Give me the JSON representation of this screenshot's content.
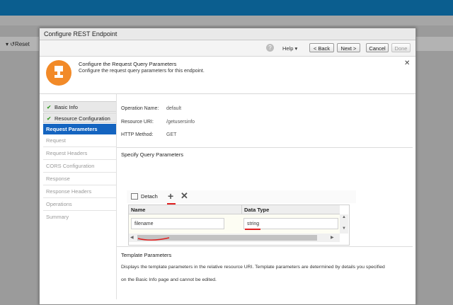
{
  "background": {
    "reset_label": "Reset"
  },
  "dialog": {
    "title": "Configure REST Endpoint",
    "toolbar": {
      "help_label": "Help",
      "back_label": "< Back",
      "next_label": "Next >",
      "cancel_label": "Cancel",
      "done_label": "Done"
    },
    "header": {
      "title": "Configure the Request Query Parameters",
      "subtitle": "Configure the request query parameters for this endpoint."
    },
    "nav": {
      "items": [
        {
          "label": "Basic Info",
          "state": "done"
        },
        {
          "label": "Resource Configuration",
          "state": "done"
        },
        {
          "label": "Request Parameters",
          "state": "active"
        },
        {
          "label": "Request",
          "state": "pending"
        },
        {
          "label": "Request Headers",
          "state": "pending"
        },
        {
          "label": "CORS Configuration",
          "state": "pending"
        },
        {
          "label": "Response",
          "state": "pending"
        },
        {
          "label": "Response Headers",
          "state": "pending"
        },
        {
          "label": "Operations",
          "state": "pending"
        },
        {
          "label": "Summary",
          "state": "pending"
        }
      ]
    },
    "summary": {
      "operation_name_label": "Operation Name:",
      "operation_name_value": "default",
      "resource_uri_label": "Resource URI:",
      "resource_uri_value": "/getusersinfo",
      "http_method_label": "HTTP Method:",
      "http_method_value": "GET"
    },
    "query_params": {
      "section_title": "Specify Query Parameters",
      "detach_label": "Detach",
      "columns": [
        "Name",
        "Data Type"
      ],
      "rows": [
        {
          "name": "filename",
          "data_type": "string"
        }
      ]
    },
    "template_params": {
      "section_title": "Template Parameters",
      "description_line1": "Displays the template parameters in the relative resource URI. Template parameters are determined by details you specified",
      "description_line2": "on the Basic Info page and cannot be edited."
    }
  },
  "colors": {
    "topbar": "#0b5e8f",
    "accent_orange": "#f28a28",
    "nav_active": "#1464c0",
    "annotation_red": "#e02020"
  }
}
